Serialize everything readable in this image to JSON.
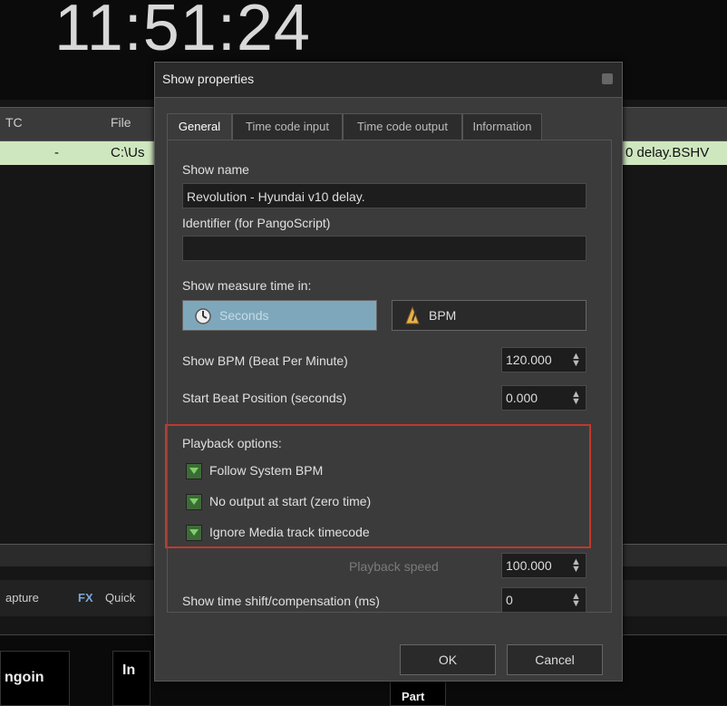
{
  "clock": "11:51:24",
  "background": {
    "headers": [
      "TC",
      "File"
    ],
    "row_tc": "-",
    "row_file": "C:\\Us",
    "row_file_right": "0 delay.BSHV",
    "tab_capture": "apture",
    "tab_quick": "Quick",
    "thumb_label_1": "ngoin",
    "thumb_label_2": "In",
    "thumb_label_3": "Part"
  },
  "dialog": {
    "title": "Show properties",
    "tabs": [
      "General",
      "Time code input",
      "Time code output",
      "Information"
    ],
    "show_name_label": "Show name",
    "show_name_value": "Revolution - Hyundai v10 delay.",
    "identifier_label": "Identifier (for PangoScript)",
    "identifier_value": "",
    "measure_label": "Show measure time in:",
    "mode_seconds": "Seconds",
    "mode_bpm": "BPM",
    "bpm_label": "Show BPM (Beat Per Minute)",
    "bpm_value": "120.000",
    "start_beat_label": "Start Beat Position (seconds)",
    "start_beat_value": "0.000",
    "playback_options_label": "Playback options:",
    "opt_follow": "Follow System BPM",
    "opt_no_output": "No output at start (zero time)",
    "opt_ignore_media": "Ignore Media track timecode",
    "playback_speed_label": "Playback speed",
    "playback_speed_value": "100.000",
    "time_shift_label": "Show time shift/compensation (ms)",
    "time_shift_value": "0",
    "ok": "OK",
    "cancel": "Cancel"
  }
}
